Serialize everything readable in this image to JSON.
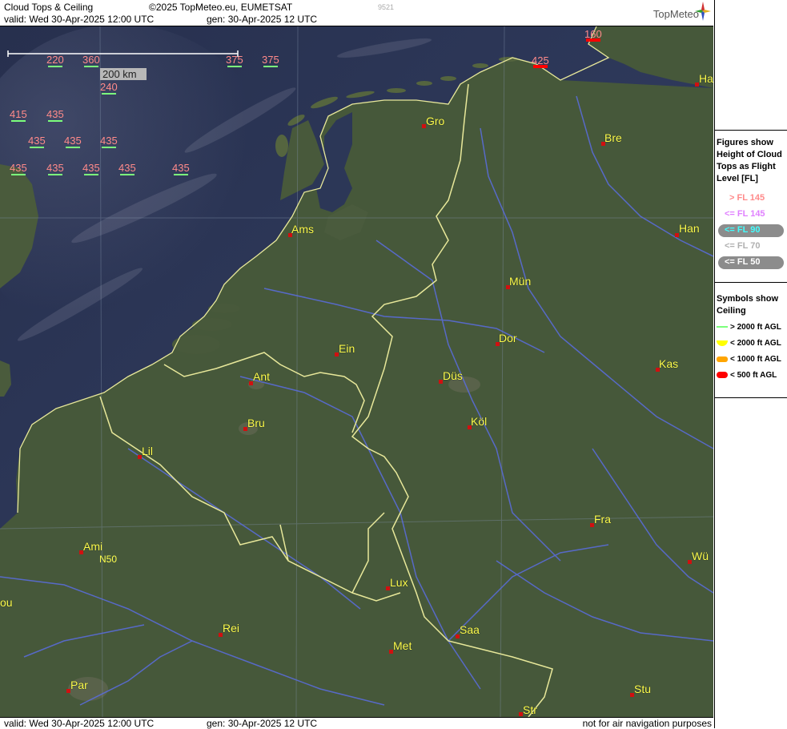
{
  "header": {
    "title": "Cloud Tops & Ceiling",
    "copyright": "©2025 TopMeteo.eu, EUMETSAT",
    "code": "9521",
    "valid": "valid:  Wed  30-Apr-2025  12:00 UTC",
    "gen": "gen: 30-Apr-2025 12 UTC",
    "logo": "TopMeteo"
  },
  "footer": {
    "valid": "valid:  Wed  30-Apr-2025  12:00 UTC",
    "gen": "gen: 30-Apr-2025 12 UTC",
    "note": "not for air navigation purposes"
  },
  "scale": {
    "label": "200 km"
  },
  "latitude_label": "N50",
  "legend": {
    "heading": [
      "Figures show",
      "Height of Cloud",
      "Tops as Flight",
      "Level  [FL]"
    ],
    "items": [
      {
        "label": "> FL 145",
        "color": "#ff8a8a",
        "pill": false
      },
      {
        "label": "<= FL 145",
        "color": "#e080ff",
        "pill": false
      },
      {
        "label": "<= FL 90",
        "color": "#40ffff",
        "pill": true
      },
      {
        "label": "<= FL 70",
        "color": "#b0b0b0",
        "pill": false
      },
      {
        "label": "<= FL 50",
        "color": "#ffffff",
        "pill": true
      }
    ],
    "symbols_heading": [
      "Symbols show",
      "Ceiling"
    ],
    "symbols": [
      {
        "label": "> 2000 ft AGL",
        "color": "#7cff7c"
      },
      {
        "label": "< 2000 ft AGL",
        "color": "#ffff00"
      },
      {
        "label": "< 1000 ft AGL",
        "color": "#ffa500"
      },
      {
        "label": "< 500 ft AGL",
        "color": "#ff0000"
      }
    ]
  },
  "cities": [
    {
      "name": "Gro"
    },
    {
      "name": "Bre"
    },
    {
      "name": "Ha"
    },
    {
      "name": "Ams"
    },
    {
      "name": "Han"
    },
    {
      "name": "Mün"
    },
    {
      "name": "Dor"
    },
    {
      "name": "Ein"
    },
    {
      "name": "Ant"
    },
    {
      "name": "Düs"
    },
    {
      "name": "Kas"
    },
    {
      "name": "Bru"
    },
    {
      "name": "Köl"
    },
    {
      "name": "Lil"
    },
    {
      "name": "Fra"
    },
    {
      "name": "Ami"
    },
    {
      "name": "Wü"
    },
    {
      "name": "Lux"
    },
    {
      "name": "ou"
    },
    {
      "name": "Rei"
    },
    {
      "name": "Saa"
    },
    {
      "name": "Met"
    },
    {
      "name": "Par"
    },
    {
      "name": "Stu"
    },
    {
      "name": "Str"
    }
  ],
  "flight_levels": [
    {
      "value": "220"
    },
    {
      "value": "360"
    },
    {
      "value": "375"
    },
    {
      "value": "375"
    },
    {
      "value": "240"
    },
    {
      "value": "415"
    },
    {
      "value": "435"
    },
    {
      "value": "435"
    },
    {
      "value": "435"
    },
    {
      "value": "435"
    },
    {
      "value": "435"
    },
    {
      "value": "435"
    },
    {
      "value": "435"
    },
    {
      "value": "435"
    },
    {
      "value": "435"
    },
    {
      "value": "160"
    },
    {
      "value": "425"
    }
  ]
}
